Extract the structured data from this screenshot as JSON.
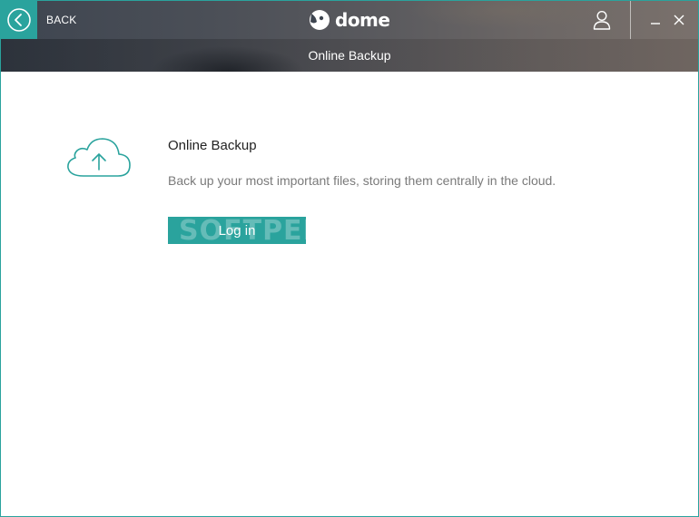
{
  "titlebar": {
    "back_label": "BACK",
    "logo_text": "dome",
    "icons": {
      "back": "chevron-left-icon",
      "user": "user-icon",
      "minimize": "minimize-icon",
      "close": "close-icon",
      "logo": "panda-logo-icon"
    }
  },
  "subtitle": "Online Backup",
  "content": {
    "icon": "cloud-upload-icon",
    "title": "Online Backup",
    "description": "Back up your most important files, storing them centrally in the cloud.",
    "login_label": "Log in"
  },
  "watermark": "SOFTPEDIA",
  "colors": {
    "accent": "#2aa39d",
    "text_dark": "#222222",
    "text_muted": "#7a7a7a"
  }
}
